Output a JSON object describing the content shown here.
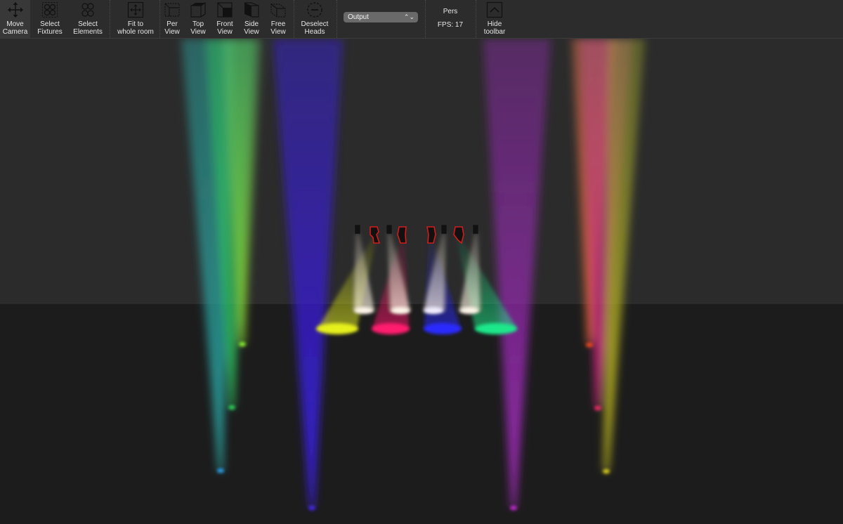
{
  "toolbar": {
    "buttons": [
      {
        "id": "move-camera",
        "label": "Move\nCamera",
        "icon": "move-arrows-icon",
        "active": true
      },
      {
        "id": "select-fixtures",
        "label": "Select\nFixtures",
        "icon": "select-fixtures-icon"
      },
      {
        "id": "select-elements",
        "label": "Select\nElements",
        "icon": "select-elements-icon"
      },
      {
        "id": "fit-room",
        "label": "Fit to\nwhole room",
        "icon": "fit-room-icon"
      },
      {
        "id": "per-view",
        "label": "Per\nView",
        "icon": "perspective-view-icon"
      },
      {
        "id": "top-view",
        "label": "Top\nView",
        "icon": "top-view-icon"
      },
      {
        "id": "front-view",
        "label": "Front\nView",
        "icon": "front-view-icon"
      },
      {
        "id": "side-view",
        "label": "Side\nView",
        "icon": "side-view-icon"
      },
      {
        "id": "free-view",
        "label": "Free\nView",
        "icon": "free-view-icon"
      },
      {
        "id": "deselect-heads",
        "label": "Deselect\nHeads",
        "icon": "deselect-icon"
      },
      {
        "id": "hide-toolbar",
        "label": "Hide\ntoolbar",
        "icon": "chevron-up-icon"
      }
    ],
    "output_select": {
      "value": "Output"
    },
    "camera_mode": "Pers",
    "fps": "FPS: 17"
  },
  "scene": {
    "background_color": "#1e1e1e",
    "wall_color": "#2b2b2b",
    "floor_color": "#1c1c1c",
    "fixture_color": "#111111",
    "moving_head_outline": "#d21c1c",
    "beams": [
      {
        "name": "cyan-beam-left",
        "color": "#2aa9a5"
      },
      {
        "name": "green-beam-left-mid",
        "color": "#2fc45c"
      },
      {
        "name": "lime-beam-left",
        "color": "#8fdc2a"
      },
      {
        "name": "blue-beam-left",
        "color": "#3a1ee0"
      },
      {
        "name": "purple-beam-right",
        "color": "#a02ab8"
      },
      {
        "name": "orange-beam-right",
        "color": "#e0622a"
      },
      {
        "name": "magenta-beam-right",
        "color": "#d0207a"
      },
      {
        "name": "yellow-beam-right",
        "color": "#c8c01e"
      }
    ],
    "floor_spots": [
      {
        "name": "yellow-spot",
        "color": "#e6f01e"
      },
      {
        "name": "pink-spot",
        "color": "#ff1a6e"
      },
      {
        "name": "blue-spot",
        "color": "#2a2aff"
      },
      {
        "name": "green-spot",
        "color": "#1ee88a"
      }
    ],
    "wall_spots_color": "#fff6ea"
  }
}
